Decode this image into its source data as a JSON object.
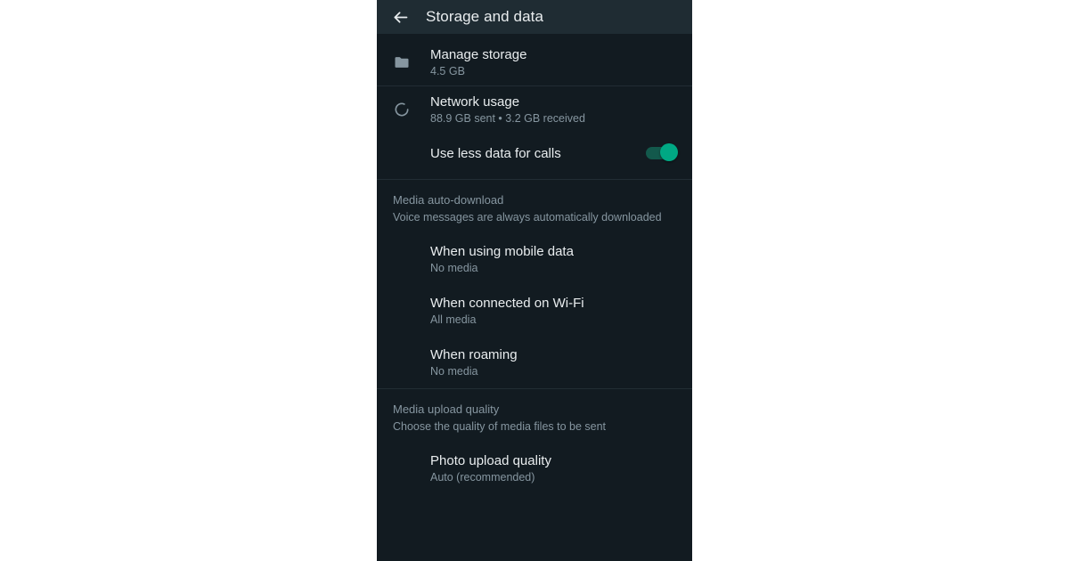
{
  "appbar": {
    "back_icon": "arrow-left-icon",
    "title": "Storage and data"
  },
  "colors": {
    "appbar_bg": "#1f2c33",
    "page_bg": "#121b21",
    "divider": "#222d34",
    "primary_text": "#e9edef",
    "secondary_text": "#8696a0",
    "accent_toggle": "#00a884",
    "toggle_track": "#13594c",
    "icon_grey": "#8696a0",
    "outer_bg": "#ffffff"
  },
  "storage_section": {
    "manage_storage": {
      "icon": "folder-icon",
      "title": "Manage storage",
      "subtitle": "4.5 GB"
    },
    "network_usage": {
      "icon": "sync-circle-icon",
      "title": "Network usage",
      "subtitle": "88.9 GB sent • 3.2 GB received"
    },
    "use_less_data": {
      "title": "Use less data for calls",
      "toggle_state": "on"
    }
  },
  "media_auto_download": {
    "header_title": "Media auto-download",
    "header_subtitle": "Voice messages are always automatically downloaded",
    "items": [
      {
        "title": "When using mobile data",
        "subtitle": "No media"
      },
      {
        "title": "When connected on Wi-Fi",
        "subtitle": "All media"
      },
      {
        "title": "When roaming",
        "subtitle": "No media"
      }
    ]
  },
  "media_upload_quality": {
    "header_title": "Media upload quality",
    "header_subtitle": "Choose the quality of media files to be sent",
    "items": [
      {
        "title": "Photo upload quality",
        "subtitle": "Auto (recommended)"
      }
    ]
  }
}
